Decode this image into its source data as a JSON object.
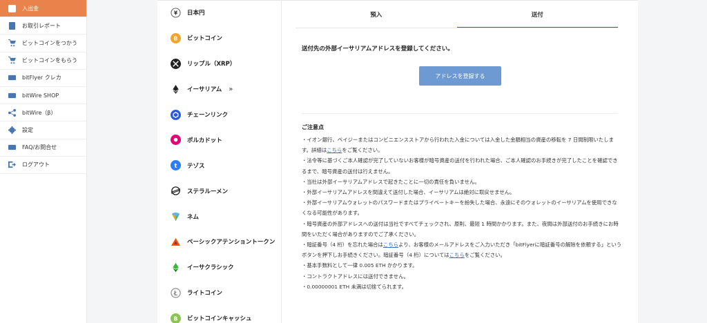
{
  "sidebar": {
    "items": [
      {
        "label": "入出金",
        "icon": "yen-icon",
        "active": true
      },
      {
        "label": "お取引レポート",
        "icon": "report-icon"
      },
      {
        "label": "ビットコインをつかう",
        "icon": "cart-icon"
      },
      {
        "label": "ビットコインをもらう",
        "icon": "cart-plus-icon"
      },
      {
        "label": "bitFlyer クレカ",
        "icon": "card-icon"
      },
      {
        "label": "bitWire SHOP",
        "icon": "shop-icon"
      },
      {
        "label": "bitWire（β）",
        "icon": "share-icon"
      },
      {
        "label": "設定",
        "icon": "gear-icon"
      },
      {
        "label": "FAQ/お問合せ",
        "icon": "mail-icon"
      },
      {
        "label": "ログアウト",
        "icon": "logout-icon"
      }
    ]
  },
  "currencies": [
    {
      "label": "日本円",
      "icon": "yen-circle-icon"
    },
    {
      "label": "ビットコイン",
      "icon": "bitcoin-icon",
      "color": "#f4a32c"
    },
    {
      "label": "リップル（XRP）",
      "icon": "xrp-icon",
      "color": "#222222"
    },
    {
      "label": "イーサリアム",
      "icon": "ethereum-icon",
      "selected": true,
      "arrow": "»"
    },
    {
      "label": "チェーンリンク",
      "icon": "chainlink-icon",
      "color": "#2a5ada"
    },
    {
      "label": "ポルカドット",
      "icon": "polkadot-icon",
      "color": "#e6007a"
    },
    {
      "label": "テゾス",
      "icon": "tezos-icon",
      "color": "#2c7df7"
    },
    {
      "label": "ステラルーメン",
      "icon": "stellar-icon",
      "color": "#222222"
    },
    {
      "label": "ネム",
      "icon": "nem-icon",
      "color": "#67b2e8"
    },
    {
      "label": "ベーシックアテンショントークン",
      "icon": "bat-icon",
      "color": "#ff5000"
    },
    {
      "label": "イーサクラシック",
      "icon": "ethereum-classic-icon",
      "color": "#3ab83a"
    },
    {
      "label": "ライトコイン",
      "icon": "litecoin-icon",
      "color": "#888888"
    },
    {
      "label": "ビットコインキャッシュ",
      "icon": "bitcoin-cash-icon",
      "color": "#8dc351"
    }
  ],
  "tabs": [
    {
      "label": "預入",
      "active": false
    },
    {
      "label": "送付",
      "active": true
    }
  ],
  "send": {
    "instruction": "送付先の外部イーサリアムアドレスを登録してください。",
    "register_button": "アドレスを登録する"
  },
  "notes": {
    "title": "ご注意点",
    "link_text": "こちら",
    "lines": [
      {
        "pre": "・イオン銀行、ペイジーまたはコンビニエンスストアから行われた入金については入金した金額相当の資産の移転を 7 日間制限いたします。詳細は",
        "link": "こちら",
        "post": "をご覧ください。"
      },
      {
        "pre": "・法令等に基づくご本人確認が完了していないお客様が暗号資産の送付を行われた場合、ご本人確認のお手続きが完了したことを確認できるまで、暗号資産の送付は行えません。"
      },
      {
        "pre": "・当社は外部イーサリアムアドレスで起きたことに一切の責任を負いません。"
      },
      {
        "pre": "・外部イーサリアムアドレスを間違えて送付した場合、イーサリアムは絶対に取戻せません。"
      },
      {
        "pre": "・外部イーサリアムウォレットのパスワードまたはプライベートキーを紛失した場合、永遠にそのウォレットのイーサリアムを使用できなくなる可能性があります。"
      },
      {
        "pre": "・暗号資産の外部アドレスへの送付は当社ですべてチェックされ、原則、最短 1 時間かかります。また、夜間は外部送付のお手続きにお時間をいただく場合がありますのでご了承ください。"
      },
      {
        "pre": "・暗証番号（4 桁）を忘れた場合は",
        "link": "こちら",
        "post": "より、お客様のメールアドレスをご入力いただき「bitFlyerに暗証番号の解除を依頼する」というボタンを押下しお手続きください。暗証番号（4 桁）については",
        "link2": "こちら",
        "post2": "をご覧ください。"
      },
      {
        "pre": "・基本手数料として一律 0.005 ETH かかります。"
      },
      {
        "pre": "・コントラクトアドレスには送付できません。"
      },
      {
        "pre": "・0.00000001 ETH 未満は切捨てられます。"
      }
    ]
  }
}
